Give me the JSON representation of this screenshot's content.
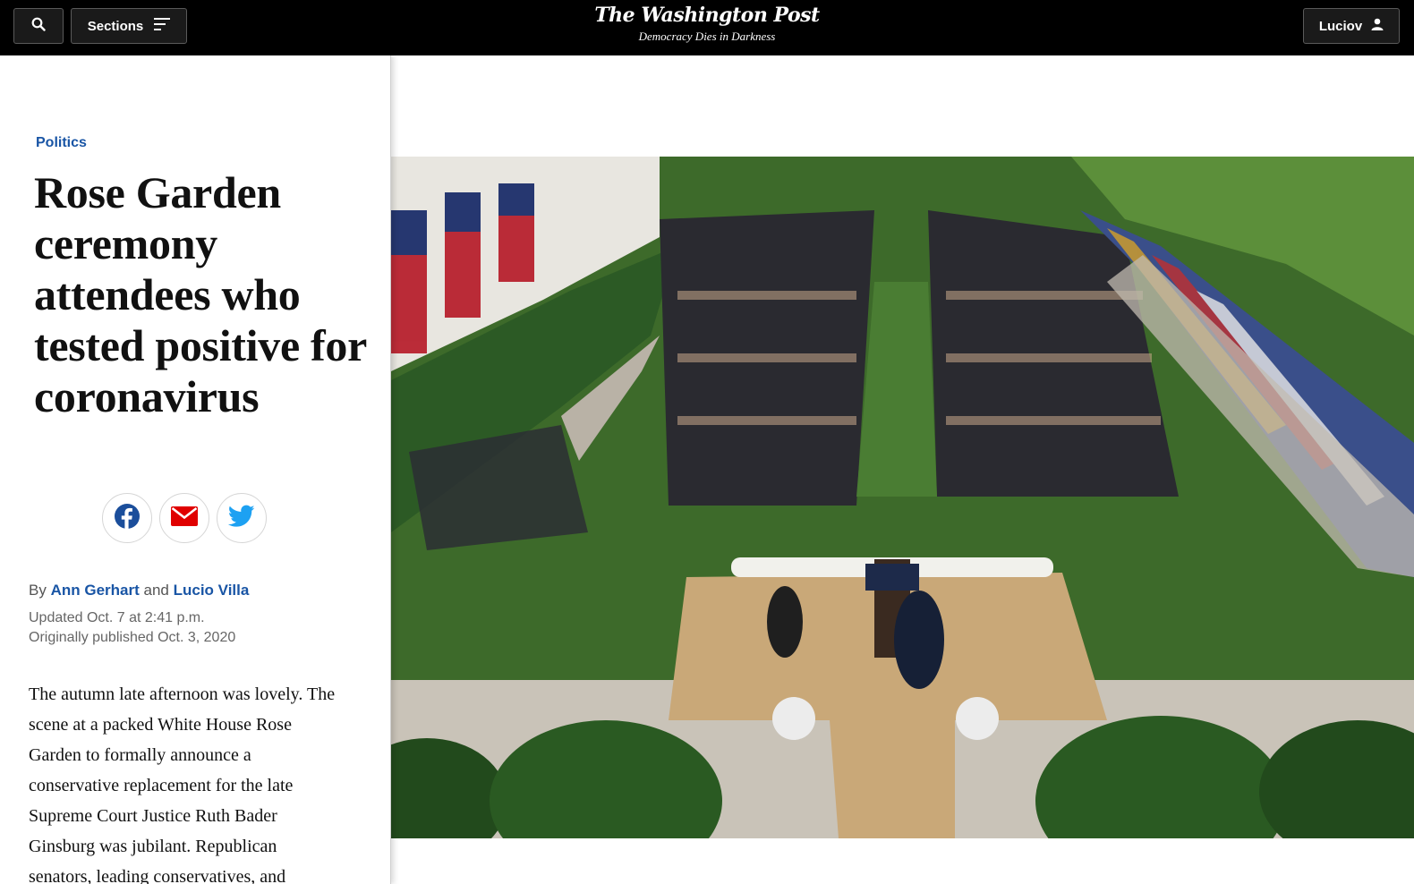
{
  "header": {
    "search_icon": "search-icon",
    "sections_label": "Sections",
    "sections_icon": "menu-lines-icon",
    "masthead_title": "The Washington Post",
    "masthead_tagline": "Democracy Dies in Darkness",
    "user_label": "Luciov",
    "user_icon": "person-icon"
  },
  "article": {
    "kicker": "Politics",
    "headline": "Rose Garden ceremony attendees who tested positive for coronavirus",
    "share": [
      {
        "name": "facebook",
        "icon": "facebook-icon",
        "color": "#1b4e9b"
      },
      {
        "name": "email",
        "icon": "email-icon",
        "color": "#e00000"
      },
      {
        "name": "twitter",
        "icon": "twitter-icon",
        "color": "#1da1f2"
      }
    ],
    "byline": {
      "prefix": "By",
      "author1": "Ann Gerhart",
      "conjunction": "and",
      "author2": "Lucio Villa"
    },
    "updated": "Updated Oct. 7 at 2:41 p.m.",
    "published": "Originally published Oct. 3, 2020",
    "body": "The autumn late afternoon was lovely. The scene at a packed White House Rose Garden to formally announce a conservative replacement for the late Supreme Court Justice Ruth Bader Ginsburg was jubilant. Republican senators, leading conservatives, and"
  },
  "media": {
    "photo_subject": "aerial view of crowded Rose Garden ceremony with podium, flags and lawn"
  },
  "colors": {
    "header_bg": "#000000",
    "link_blue": "#1955a5",
    "headline_text": "#111111",
    "lawn_green": "#3d6a2a"
  }
}
